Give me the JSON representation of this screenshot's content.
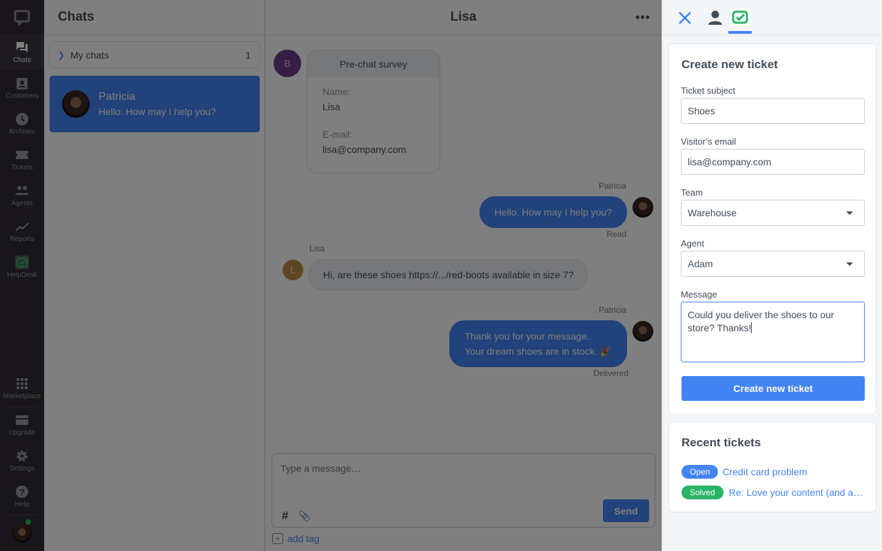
{
  "nav": {
    "items": [
      {
        "label": "Chats",
        "icon": "chats-icon",
        "active": true
      },
      {
        "label": "Customers",
        "icon": "customers-icon"
      },
      {
        "label": "Archives",
        "icon": "archives-icon"
      },
      {
        "label": "Tickets",
        "icon": "tickets-icon"
      },
      {
        "label": "Agents",
        "icon": "agents-icon"
      },
      {
        "label": "Reports",
        "icon": "reports-icon"
      },
      {
        "label": "HelpDesk",
        "icon": "helpdesk-icon"
      }
    ],
    "bottom_items": [
      {
        "label": "Marketplace",
        "icon": "grid-icon"
      },
      {
        "label": "Upgrade",
        "icon": "card-icon"
      },
      {
        "label": "Settings",
        "icon": "gear-icon"
      },
      {
        "label": "Help",
        "icon": "help-icon"
      }
    ]
  },
  "chats": {
    "title": "Chats",
    "group": {
      "label": "My chats",
      "count": "1"
    },
    "items": [
      {
        "name": "Patricia",
        "preview": "Hello. How may I help you?"
      }
    ]
  },
  "conversation": {
    "title": "Lisa",
    "more_icon": "•••",
    "bot_initial": "B",
    "survey": {
      "title": "Pre-chat survey",
      "fields": [
        {
          "key": "Name:",
          "value": "Lisa"
        },
        {
          "key": "E-mail:",
          "value": "lisa@company.com"
        }
      ]
    },
    "messages": [
      {
        "author": "Patricia",
        "text": "Hello. How may I help you?",
        "status": "Read"
      },
      {
        "author": "Lisa",
        "initial": "L",
        "text": "Hi, are these shoes https://.../red-boots available in size 7?"
      },
      {
        "author": "Patricia",
        "line1": "Thank you for your message.",
        "line2": "Your dream shoes are in stock. 🎉",
        "status": "Delivered"
      }
    ],
    "composer": {
      "placeholder": "Type a message…",
      "hash": "#",
      "clip": "📎",
      "send_label": "Send"
    },
    "add_tag": {
      "plus": "+",
      "label": "add tag"
    }
  },
  "panel": {
    "create": {
      "title": "Create new ticket",
      "subject_label": "Ticket subject",
      "subject_value": "Shoes",
      "email_label": "Visitor’s email",
      "email_value": "lisa@company.com",
      "team_label": "Team",
      "team_value": "Warehouse",
      "agent_label": "Agent",
      "agent_value": "Adam",
      "message_label": "Message",
      "message_value": "Could you deliver the shoes to our store? Thanks!",
      "button_label": "Create new ticket"
    },
    "recent": {
      "title": "Recent tickets",
      "tickets": [
        {
          "status": "Open",
          "status_color": "#4384f5",
          "subject": "Credit card problem"
        },
        {
          "status": "Solved",
          "status_color": "#2ab465",
          "subject": "Re: Love your content (and a…"
        }
      ]
    }
  },
  "colors": {
    "accent": "#4384f5",
    "nav_bg": "#302c34",
    "success": "#2ab465"
  }
}
